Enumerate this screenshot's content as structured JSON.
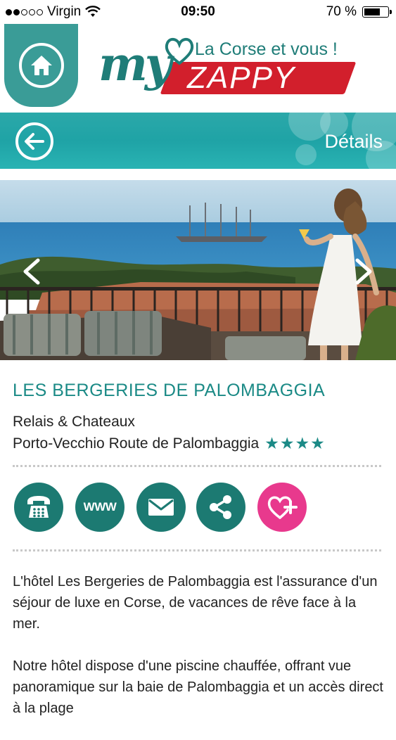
{
  "status_bar": {
    "carrier": "Virgin",
    "time": "09:50",
    "battery": "70 %",
    "battery_level": 0.7,
    "signal_bars_filled": 2,
    "signal_bars_total": 5
  },
  "header": {
    "logo_my": "my",
    "logo_tagline": "La Corse et vous !",
    "logo_brand": "ZAPPY",
    "home_icon": "home-icon"
  },
  "subheader": {
    "title": "Détails",
    "back_icon": "back-arrow-icon"
  },
  "carousel": {
    "prev_icon": "chevron-left-icon",
    "next_icon": "chevron-right-icon"
  },
  "listing": {
    "name": "LES BERGERIES DE PALOMBAGGIA",
    "category": "Relais & Chateaux",
    "address": "Porto-Vecchio Route de Palombaggia",
    "stars": "★★★★",
    "star_count": 4
  },
  "actions": [
    {
      "name": "phone",
      "icon": "phone-icon",
      "label": ""
    },
    {
      "name": "website",
      "icon": "www-icon",
      "label": "WWW"
    },
    {
      "name": "email",
      "icon": "envelope-icon",
      "label": ""
    },
    {
      "name": "share",
      "icon": "share-icon",
      "label": ""
    },
    {
      "name": "favorite",
      "icon": "heart-plus-icon",
      "label": ""
    }
  ],
  "description": {
    "p1": "L'hôtel Les Bergeries de Palombaggia est l'assurance d'un séjour de luxe en Corse, de vacances de rêve face à la mer.",
    "p2": "Notre hôtel dispose d'une piscine chauffée, offrant vue panoramique sur la baie de Palombaggia et un accès direct à la plage"
  },
  "colors": {
    "teal": "#1b8a86",
    "teal_dark": "#1c7a72",
    "accent_red": "#d21f2c",
    "accent_pink": "#e8398d"
  }
}
